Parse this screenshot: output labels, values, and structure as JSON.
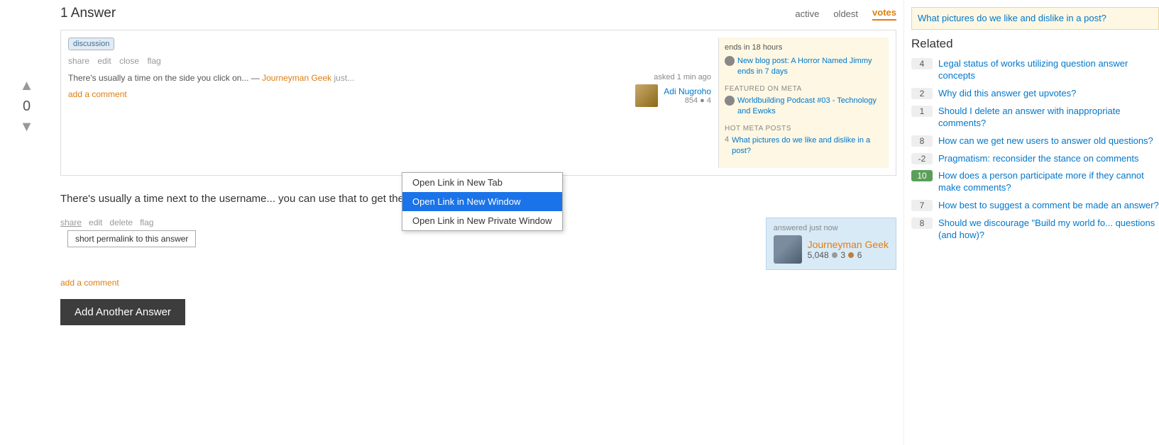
{
  "answer_count": "1 Answer",
  "sort_tabs": [
    {
      "label": "active",
      "active": false
    },
    {
      "label": "oldest",
      "active": false
    },
    {
      "label": "votes",
      "active": true
    }
  ],
  "screenshot_panel": {
    "tag": "discussion",
    "actions": [
      "share",
      "edit",
      "close",
      "flag"
    ],
    "quote_text": "There's usually a time on the side you click on...",
    "quote_author": "Journeyman Geek",
    "add_comment": "add a comment",
    "asked_label": "asked 1 min ago",
    "user_name": "Adi Nugroho",
    "user_rep": "854",
    "user_badges": "● 4",
    "sidebar": {
      "time_text": "ends in 18 hours",
      "new_blog": "New blog post: A Horror Named Jimmy ends in 7 days",
      "featured_meta_header": "FEATURED ON META",
      "featured_item": "Worldbuilding Podcast #03 - Technology and Ewoks",
      "hot_meta_header": "HOT META POSTS",
      "hot_score": "4",
      "hot_text": "What pictures do we like and dislike in a post?"
    }
  },
  "context_menu": {
    "items": [
      {
        "label": "Open Link in New Tab",
        "highlighted": false
      },
      {
        "label": "Open Link in New Window",
        "highlighted": true
      },
      {
        "label": "Open Link in New Private Window",
        "highlighted": false
      }
    ]
  },
  "answer_body": "There's usually a time next to the username... you can use that to get the link for a comment",
  "answer_actions": {
    "share_label": "share",
    "edit_label": "edit",
    "delete_label": "delete",
    "flag_label": "flag"
  },
  "permalink_tooltip": "short permalink to this answer",
  "answered_label": "answered just now",
  "answerer": {
    "name": "Journeyman Geek",
    "rep": "5,048",
    "silver_count": "3",
    "bronze_count": "6"
  },
  "add_comment_label": "add a comment",
  "add_answer_button": "Add Another Answer",
  "right_sidebar": {
    "top_yellow_text": "What pictures do we like and dislike in a post?",
    "related_header": "Related",
    "items": [
      {
        "score": "4",
        "highlighted": false,
        "text": "Legal status of works utilizing question answer concepts"
      },
      {
        "score": "2",
        "highlighted": false,
        "text": "Why did this answer get upvotes?"
      },
      {
        "score": "1",
        "highlighted": false,
        "text": "Should I delete an answer with inappropriate comments?"
      },
      {
        "score": "8",
        "highlighted": false,
        "text": "How can we get new users to answer old questions?"
      },
      {
        "score": "-2",
        "highlighted": false,
        "text": "Pragmatism: reconsider the stance on comments"
      },
      {
        "score": "10",
        "highlighted": true,
        "text": "How does a person participate more if they cannot make comments?"
      },
      {
        "score": "7",
        "highlighted": false,
        "text": "How best to suggest a comment be made an answer?"
      },
      {
        "score": "8",
        "highlighted": false,
        "text": "Should we discourage \"Build my world fo... questions (and how)?"
      }
    ]
  }
}
